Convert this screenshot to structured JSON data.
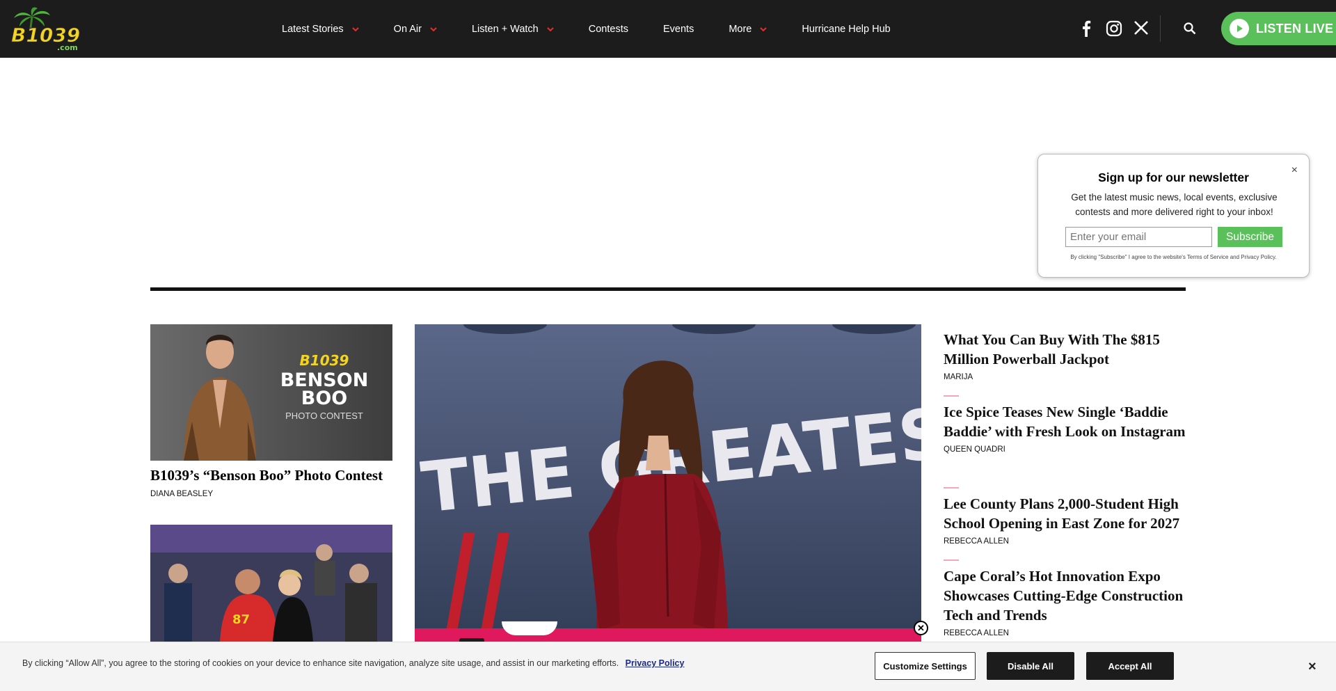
{
  "header": {
    "logo_text": "B1039",
    "logo_sub": ".com",
    "nav": [
      {
        "label": "Latest Stories",
        "has_dropdown": true
      },
      {
        "label": "On Air",
        "has_dropdown": true
      },
      {
        "label": "Listen + Watch",
        "has_dropdown": true
      },
      {
        "label": "Contests",
        "has_dropdown": false
      },
      {
        "label": "Events",
        "has_dropdown": false
      },
      {
        "label": "More",
        "has_dropdown": true
      },
      {
        "label": "Hurricane Help Hub",
        "has_dropdown": false
      }
    ],
    "social_icons": [
      "facebook-icon",
      "instagram-icon",
      "x-icon"
    ],
    "listen_live": "LISTEN LIVE"
  },
  "newsletter": {
    "title": "Sign up for our newsletter",
    "description": "Get the latest music news, local events, exclusive contests and more delivered right to your inbox!",
    "email_placeholder": "Enter your email",
    "subscribe": "Subscribe",
    "legal": "By clicking \"Subscribe\" I agree to the website's Terms of Service and Privacy Policy.",
    "close": "×"
  },
  "left_column": [
    {
      "image_text": {
        "brand": "B1039",
        "title_line1": "BENSON",
        "title_line2": "BOO",
        "subtitle": "PHOTO CONTEST"
      },
      "title": "B1039’s “Benson Boo” Photo Contest",
      "author": "DIANA BEASLEY"
    }
  ],
  "hero": {
    "backdrop_text": "THE GREATEST"
  },
  "stories": [
    {
      "title": "What You Can Buy With The $815 Million Powerball Jackpot",
      "author": "MARIJA"
    },
    {
      "title": "Ice Spice Teases New Single ‘Baddie Baddie’ with Fresh Look on Instagram",
      "author": "QUEEN QUADRI"
    },
    {
      "title": "Lee County Plans 2,000-Student High School Opening in East Zone for 2027",
      "author": "REBECCA ALLEN"
    },
    {
      "title": "Cape Coral’s Hot Innovation Expo Showcases Cutting-Edge Construction Tech and Trends",
      "author": "REBECCA ALLEN"
    }
  ],
  "cookie": {
    "message": "By clicking “Allow All”, you agree to the storing of cookies on your device to enhance site navigation, analyze site usage, and assist in our marketing efforts.",
    "policy_link": "Privacy Policy",
    "customize": "Customize Settings",
    "disable": "Disable All",
    "accept": "Accept All",
    "close": "×"
  },
  "colors": {
    "header_bg": "#1c1c1c",
    "accent_green": "#5ac15a",
    "nav_chevron": "#e2312c",
    "hero_bar": "#e0195e"
  }
}
